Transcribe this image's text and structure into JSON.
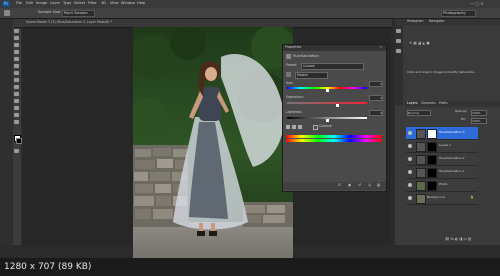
{
  "menubar": {
    "items": [
      "Ps",
      "File",
      "Edit",
      "Image",
      "Layer",
      "Type",
      "Select",
      "Filter",
      "3D",
      "View",
      "Window",
      "Help"
    ]
  },
  "optbar": {
    "sample_size_label": "Sample Size:",
    "sample_size_value": "Point Sample",
    "workspace": "Photography"
  },
  "document": {
    "tab_title": "Vyana Maziel 3 (3)  (Hue/Saturation 3, Layer Mask/8) *"
  },
  "properties": {
    "title": "Properties",
    "panel_name": "Hue/Saturation",
    "preset_label": "Preset:",
    "preset_value": "Custom",
    "channel_value": "Master",
    "hue_label": "Hue:",
    "hue_value": "0",
    "saturation_label": "Saturation:",
    "saturation_value": "0",
    "lightness_label": "Lightness:",
    "lightness_value": "0",
    "colorize_label": "Colorize",
    "range_left": "",
    "range_right": ""
  },
  "histogram": {
    "tab": "Histogram",
    "tab2": "Navigator",
    "text": "Click and drag in image to modify Saturation."
  },
  "layers": {
    "tab": "Layers",
    "tab2": "Channels",
    "tab3": "Paths",
    "blend_mode": "Normal",
    "opacity_label": "Opacity:",
    "opacity_value": "100%",
    "fill_label": "Fill:",
    "fill_value": "100%",
    "rows": [
      {
        "name": "Hue/Saturation 3"
      },
      {
        "name": "Levels 1"
      },
      {
        "name": "Hue/Saturation 2"
      },
      {
        "name": "Hue/Saturation 1"
      },
      {
        "name": "Photo"
      },
      {
        "name": "Background"
      }
    ]
  },
  "status": {
    "caption": "1280 x 707 (89 KB)"
  },
  "colors": {
    "accent": "#2d6bd6"
  }
}
